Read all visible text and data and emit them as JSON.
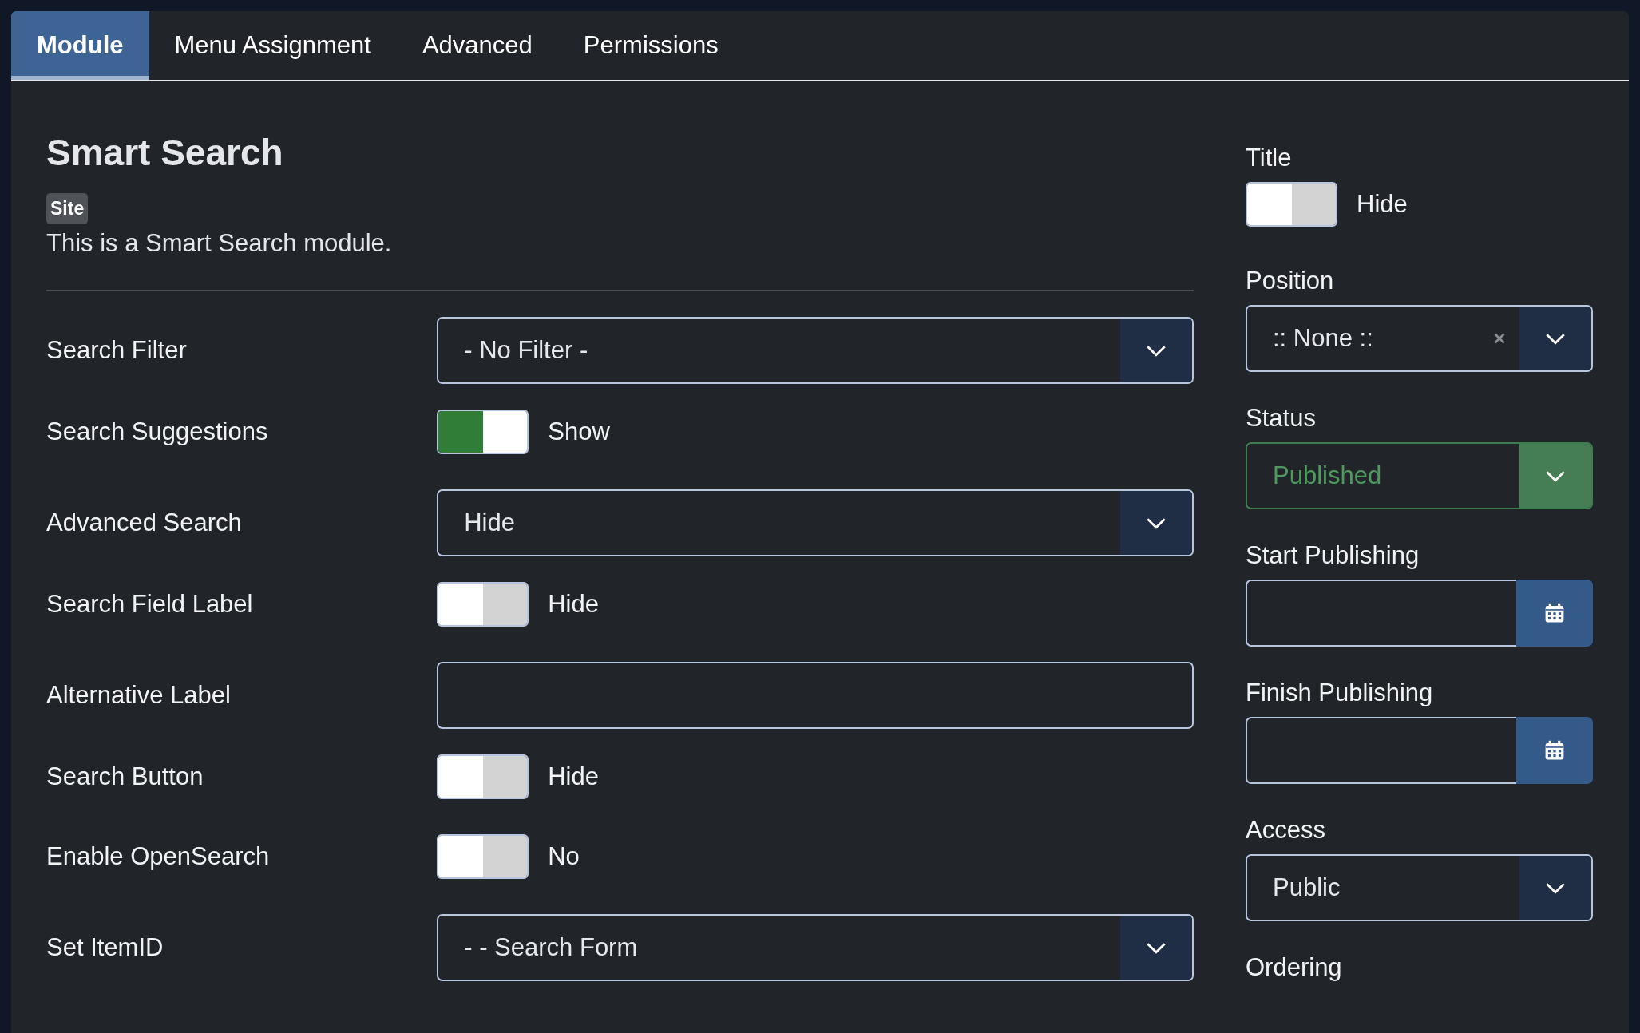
{
  "tabs": [
    {
      "label": "Module",
      "selected": true
    },
    {
      "label": "Menu Assignment",
      "selected": false
    },
    {
      "label": "Advanced",
      "selected": false
    },
    {
      "label": "Permissions",
      "selected": false
    }
  ],
  "module": {
    "title": "Smart Search",
    "badge": "Site",
    "description": "This is a Smart Search module."
  },
  "fields": [
    {
      "kind": "select",
      "label": "Search Filter",
      "value": "- No Filter -"
    },
    {
      "kind": "toggle",
      "label": "Search Suggestions",
      "on": true,
      "state_label": "Show"
    },
    {
      "kind": "select",
      "label": "Advanced Search",
      "value": "Hide"
    },
    {
      "kind": "toggle",
      "label": "Search Field Label",
      "on": false,
      "state_label": "Hide"
    },
    {
      "kind": "input",
      "label": "Alternative Label"
    },
    {
      "kind": "toggle",
      "label": "Search Button",
      "on": false,
      "state_label": "Hide"
    },
    {
      "kind": "toggle",
      "label": "Enable OpenSearch",
      "on": false,
      "state_label": "No"
    },
    {
      "kind": "select",
      "label": "Set ItemID",
      "value": "- - Search Form"
    }
  ],
  "sidebar": [
    {
      "kind": "toggle",
      "label": "Title",
      "on": false,
      "state_label": "Hide"
    },
    {
      "kind": "select",
      "label": "Position",
      "value": ":: None ::",
      "clearable": true
    },
    {
      "kind": "status",
      "label": "Status",
      "value": "Published"
    },
    {
      "kind": "date",
      "label": "Start Publishing"
    },
    {
      "kind": "date",
      "label": "Finish Publishing"
    },
    {
      "kind": "select",
      "label": "Access",
      "value": "Public"
    },
    {
      "kind": "heading",
      "label": "Ordering"
    }
  ]
}
